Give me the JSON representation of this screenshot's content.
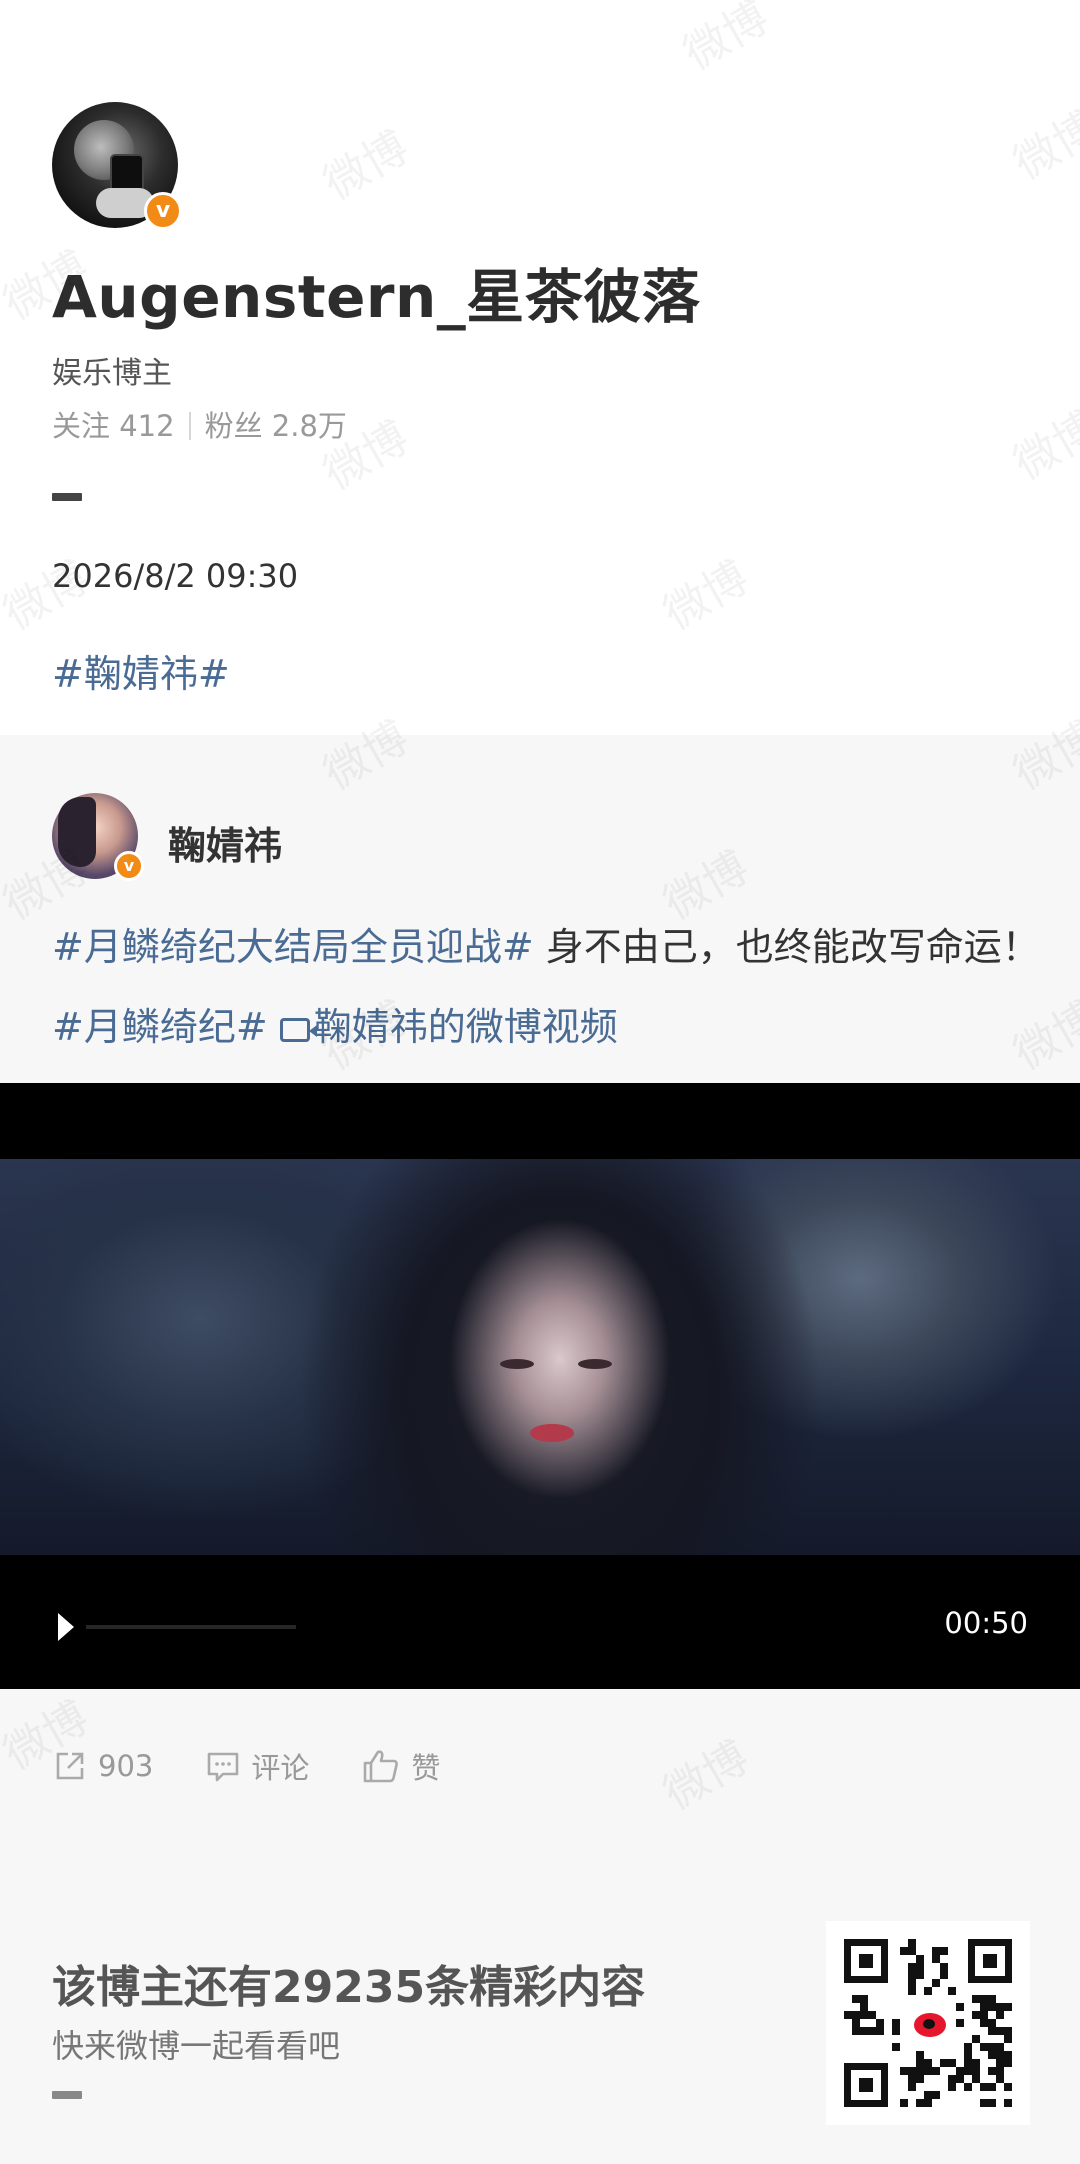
{
  "poster": {
    "name": "Augenstern_星茶彼落",
    "role": "娱乐博主",
    "follow_label": "关注 412",
    "fans_label": "粉丝 2.8万",
    "time": "2026/8/2 09:30",
    "hashtag": "#鞠婧祎#"
  },
  "original": {
    "author": "鞠婧祎",
    "hashtag1": "#月鳞绮纪大结局全员迎战#",
    "text": " 身不由己，也终能改写命运！ ",
    "hashtag2": "#月鳞绮纪#",
    "video_link": "鞠婧祎的微博视频"
  },
  "video": {
    "duration": "00:50"
  },
  "actions": {
    "repost_count": "903",
    "comment_label": "评论",
    "like_label": "赞"
  },
  "promo": {
    "title": "该博主还有29235条精彩内容",
    "subtitle": "快来微博一起看看吧"
  },
  "watermark": "微博",
  "colors": {
    "link": "#4a6b94",
    "verified_badge": "#f28a16",
    "card_bg": "#f7f7f7"
  },
  "icons": [
    "verified-badge-icon",
    "video-link-icon",
    "play-icon",
    "repost-icon",
    "comment-icon",
    "like-icon",
    "qr-code"
  ]
}
